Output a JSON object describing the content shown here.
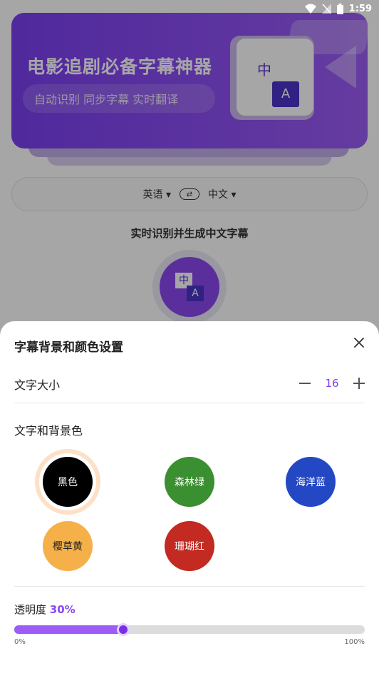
{
  "status_bar": {
    "time": "1:59"
  },
  "background": {
    "banner_title": "电影追剧必备字幕神器",
    "banner_subtitle": "自动识别 同步字幕 实时翻译",
    "icon_zh": "中",
    "icon_a": "A",
    "source_lang": "英语",
    "target_lang": "中文",
    "swap_symbol": "⇄",
    "tip": "实时识别并生成中文字幕"
  },
  "sheet": {
    "title": "字幕背景和颜色设置",
    "font_size_label": "文字大小",
    "font_size_value": "16",
    "color_label": "文字和背景色",
    "swatches": [
      {
        "label": "黑色",
        "bg": "#000000",
        "fg": "#ffffff",
        "selected": true
      },
      {
        "label": "森林绿",
        "bg": "#3a8f30",
        "fg": "#ffffff",
        "selected": false
      },
      {
        "label": "海洋蓝",
        "bg": "#2447c4",
        "fg": "#ffffff",
        "selected": false
      },
      {
        "label": "樱草黄",
        "bg": "#f5b049",
        "fg": "#222222",
        "selected": false
      },
      {
        "label": "珊瑚红",
        "bg": "#c22a22",
        "fg": "#ffffff",
        "selected": false
      }
    ],
    "opacity_label": "透明度",
    "opacity_value": "30%",
    "opacity_fraction": 0.31,
    "slider_min": "0%",
    "slider_max": "100%"
  },
  "colors": {
    "accent": "#8a49f0"
  }
}
